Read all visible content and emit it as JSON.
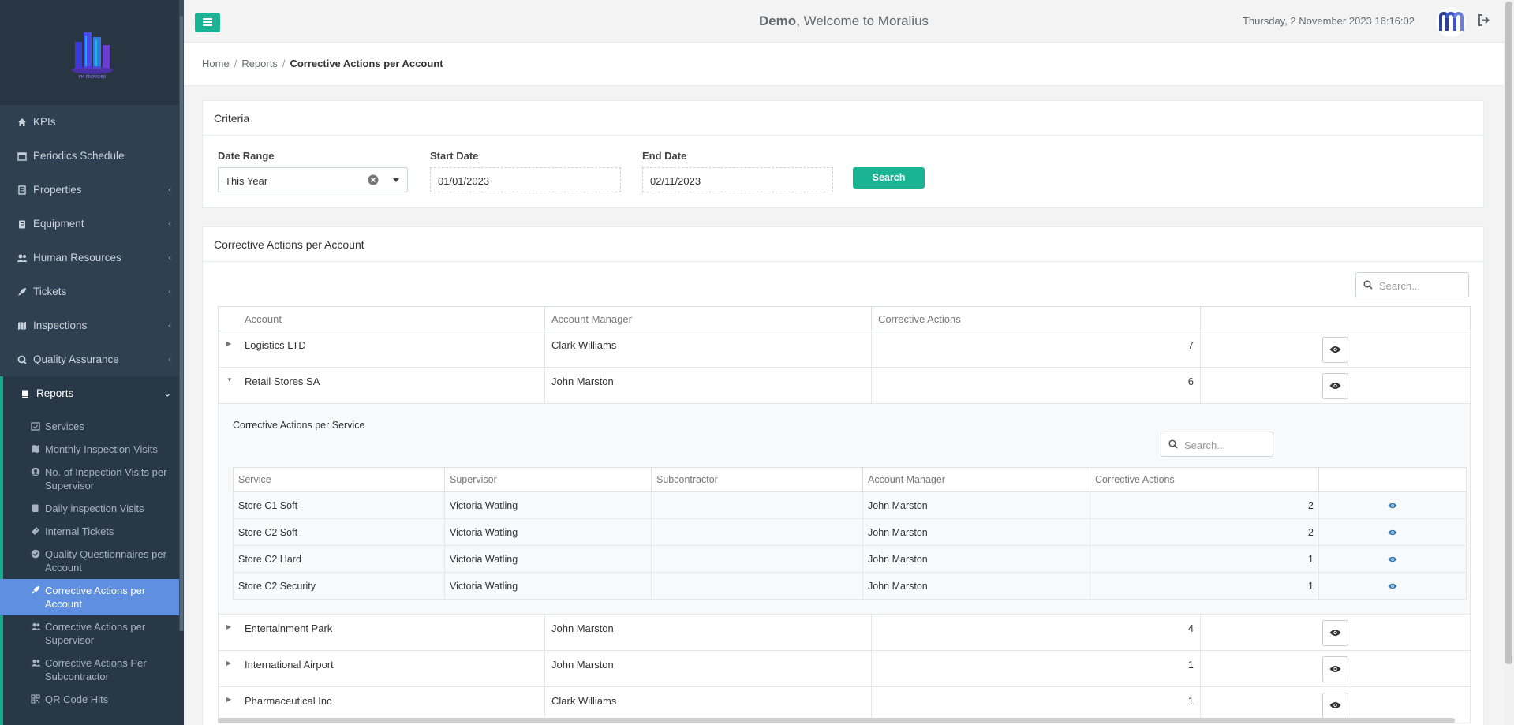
{
  "sidebar": {
    "items": [
      {
        "label": "KPIs",
        "icon": "home-icon",
        "has_chevron": false
      },
      {
        "label": "Periodics Schedule",
        "icon": "calendar-icon",
        "has_chevron": false
      },
      {
        "label": "Properties",
        "icon": "building-icon",
        "has_chevron": true
      },
      {
        "label": "Equipment",
        "icon": "clipboard-icon",
        "has_chevron": true
      },
      {
        "label": "Human Resources",
        "icon": "users-icon",
        "has_chevron": true
      },
      {
        "label": "Tickets",
        "icon": "rocket-icon",
        "has_chevron": true
      },
      {
        "label": "Inspections",
        "icon": "map-icon",
        "has_chevron": true
      },
      {
        "label": "Quality Assurance",
        "icon": "q-icon",
        "has_chevron": true
      }
    ],
    "reports": {
      "label": "Reports",
      "sub_items": [
        {
          "label": "Services",
          "icon": "calendar-check-icon"
        },
        {
          "label": "Monthly Inspection Visits",
          "icon": "map-icon"
        },
        {
          "label": "No. of Inspection Visits per Supervisor",
          "icon": "user-circle-icon"
        },
        {
          "label": "Daily inspection Visits",
          "icon": "book-icon"
        },
        {
          "label": "Internal Tickets",
          "icon": "ticket-icon"
        },
        {
          "label": "Quality Questionnaires per Account",
          "icon": "check-circle-icon"
        },
        {
          "label": "Corrective Actions per Account",
          "icon": "rocket-icon",
          "active": true
        },
        {
          "label": "Corrective Actions per Supervisor",
          "icon": "users-icon"
        },
        {
          "label": "Corrective Actions Per Subcontractor",
          "icon": "users-icon"
        },
        {
          "label": "QR Code Hits",
          "icon": "qrcode-icon"
        }
      ]
    }
  },
  "header": {
    "user": "Demo",
    "welcome_text": ", Welcome to Moralius",
    "datetime": "Thursday, 2 November 2023 16:16:02"
  },
  "breadcrumb": {
    "home": "Home",
    "reports": "Reports",
    "current": "Corrective Actions per Account"
  },
  "criteria": {
    "title": "Criteria",
    "date_range_label": "Date Range",
    "date_range_value": "This Year",
    "start_label": "Start Date",
    "start_value": "01/01/2023",
    "end_label": "End Date",
    "end_value": "02/11/2023",
    "search_button": "Search"
  },
  "results": {
    "title": "Corrective Actions per Account",
    "search_placeholder": "Search...",
    "columns": [
      "Account",
      "Account Manager",
      "Corrective Actions",
      ""
    ],
    "rows_before": [
      {
        "account": "Logistics LTD",
        "manager": "Clark Williams",
        "actions": "7"
      },
      {
        "account": "Retail Stores SA",
        "manager": "John Marston",
        "actions": "6"
      }
    ],
    "detail": {
      "title": "Corrective Actions per Service",
      "search_placeholder": "Search...",
      "columns": [
        "Service",
        "Supervisor",
        "Subcontractor",
        "Account Manager",
        "Corrective Actions",
        ""
      ],
      "rows": [
        {
          "service": "Store C1 Soft",
          "supervisor": "Victoria Watling",
          "subcontractor": "",
          "manager": "John Marston",
          "actions": "2"
        },
        {
          "service": "Store C2 Soft",
          "supervisor": "Victoria Watling",
          "subcontractor": "",
          "manager": "John Marston",
          "actions": "2"
        },
        {
          "service": "Store C2 Hard",
          "supervisor": "Victoria Watling",
          "subcontractor": "",
          "manager": "John Marston",
          "actions": "1"
        },
        {
          "service": "Store C2 Security",
          "supervisor": "Victoria Watling",
          "subcontractor": "",
          "manager": "John Marston",
          "actions": "1"
        }
      ]
    },
    "rows_after": [
      {
        "account": "Entertainment Park",
        "manager": "John Marston",
        "actions": "4"
      },
      {
        "account": "International Airport",
        "manager": "John Marston",
        "actions": "1"
      },
      {
        "account": "Pharmaceutical Inc",
        "manager": "Clark Williams",
        "actions": "1"
      }
    ]
  },
  "colors": {
    "sidebar_bg": "#2f4050",
    "accent_green": "#1ab394",
    "active_blue": "#5e8fe0"
  }
}
